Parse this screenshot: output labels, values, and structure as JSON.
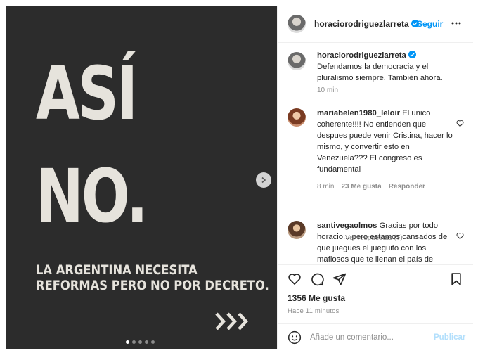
{
  "post": {
    "headline_line1": "ASÍ",
    "headline_line2": "NO.",
    "subline_1": "LA ARGENTINA NECESITA",
    "subline_2": "REFORMAS PERO NO POR DECRETO.",
    "carousel_dots": 5,
    "active_dot": 0
  },
  "header": {
    "username": "horaciorodriguezlarreta",
    "follow_label": "Seguir"
  },
  "comments": [
    {
      "username": "horaciorodriguezlarreta",
      "verified": true,
      "text": "Defendamos la democracia y el pluralismo siempre. También ahora.",
      "time": "10 min"
    },
    {
      "username": "mariabelen1980_leloir",
      "text": "El unico coherente!!!! No entienden que despues puede venir Cristina, hacer lo mismo, y convertir esto en Venezuela??? El congreso es fundamental",
      "time": "8 min",
      "likes": "23 Me gusta",
      "reply": "Responder",
      "view_replies": "Ver respuestas (7)"
    },
    {
      "username": "santivegaolmos",
      "text": "Gracias por todo horacio... pero estamos cansados de que juegues el jueguito con los mafiosos que te llenan el país de"
    }
  ],
  "actions": {
    "likes": "1356 Me gusta",
    "time": "Hace 11 minutos"
  },
  "composer": {
    "placeholder": "Añade un comentario...",
    "post_label": "Publicar"
  },
  "colors": {
    "image_bg": "#2c2c2c",
    "image_text": "#e6e3dc",
    "accent": "#0095f6",
    "muted": "#8e8e8e"
  },
  "icons": [
    "chevron-right-icon",
    "verified-icon",
    "more-icon",
    "heart-icon",
    "comment-icon",
    "share-icon",
    "bookmark-icon",
    "emoji-icon"
  ]
}
